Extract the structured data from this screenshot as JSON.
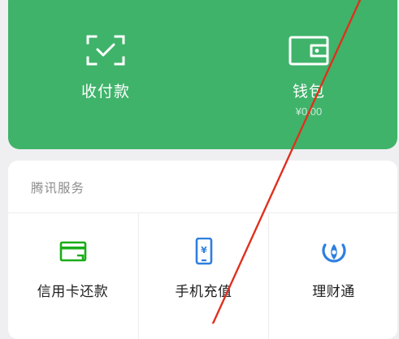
{
  "payment_card": {
    "collect_pay_label": "收付款",
    "wallet_label": "钱包",
    "wallet_balance": "¥0.00",
    "background_color": "#3fb36a"
  },
  "services": {
    "section_title": "腾讯服务",
    "items": [
      {
        "label": "信用卡还款",
        "icon": "credit-card-icon"
      },
      {
        "label": "手机充值",
        "icon": "phone-topup-icon"
      },
      {
        "label": "理财通",
        "icon": "wealth-icon"
      }
    ]
  },
  "annotation": {
    "arrow_color": "#e0301e",
    "icon_color": "#1aad19",
    "topup_icon_color": "#2e7fe0"
  }
}
